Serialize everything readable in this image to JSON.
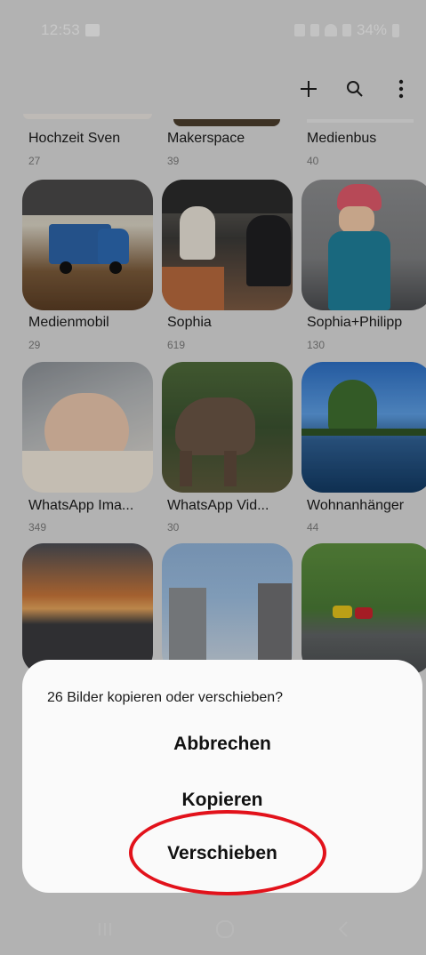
{
  "status": {
    "time": "12:53",
    "battery": "34%"
  },
  "toolbar": {
    "add": "+",
    "search": "search",
    "more": "more"
  },
  "albums": [
    {
      "name": "Hochzeit Sven",
      "count": "27"
    },
    {
      "name": "Makerspace",
      "count": "39"
    },
    {
      "name": "Medienbus",
      "count": "40"
    },
    {
      "name": "Medienmobil",
      "count": "29"
    },
    {
      "name": "Sophia",
      "count": "619"
    },
    {
      "name": "Sophia+Philipp",
      "count": "130"
    },
    {
      "name": "WhatsApp Ima...",
      "count": "349"
    },
    {
      "name": "WhatsApp Vid...",
      "count": "30"
    },
    {
      "name": "Wohnanhänger",
      "count": "44"
    }
  ],
  "dialog": {
    "question": "26 Bilder kopieren oder verschieben?",
    "cancel": "Abbrechen",
    "copy": "Kopieren",
    "move": "Verschieben"
  },
  "colors": {
    "highlight": "#e2121b"
  }
}
